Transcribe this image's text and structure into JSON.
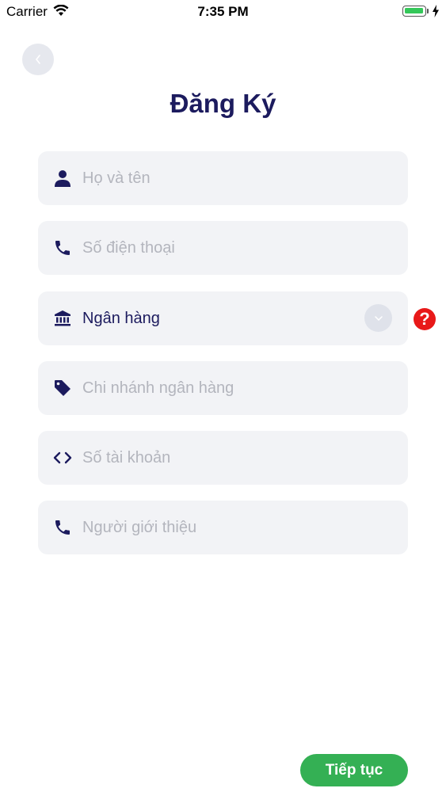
{
  "status_bar": {
    "carrier": "Carrier",
    "time": "7:35 PM"
  },
  "page": {
    "title": "Đăng Ký"
  },
  "fields": [
    {
      "icon": "user-icon",
      "placeholder": "Họ và tên",
      "value": ""
    },
    {
      "icon": "phone-icon",
      "placeholder": "Số điện thoại",
      "value": ""
    },
    {
      "icon": "bank-icon",
      "placeholder": "",
      "value": "Ngân hàng"
    },
    {
      "icon": "tag-icon",
      "placeholder": "Chi nhánh ngân hàng",
      "value": ""
    },
    {
      "icon": "code-icon",
      "placeholder": "Số tài khoản",
      "value": ""
    },
    {
      "icon": "phone-icon",
      "placeholder": "Người giới thiệu",
      "value": ""
    }
  ],
  "help": {
    "label": "?"
  },
  "actions": {
    "continue_label": "Tiếp tục"
  },
  "colors": {
    "primary": "#1c1b5e",
    "field_bg": "#f2f3f6",
    "button": "#34b054",
    "help": "#e81919"
  }
}
